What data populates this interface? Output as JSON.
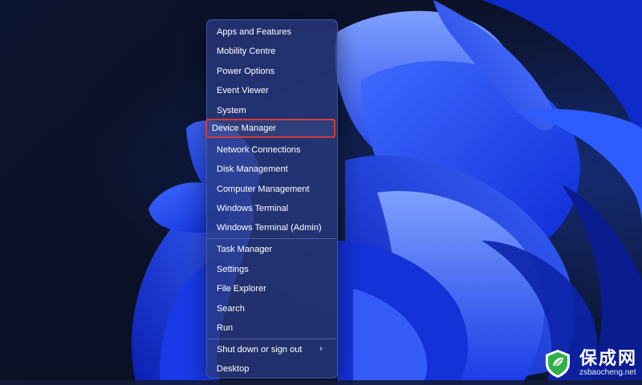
{
  "context_menu": {
    "items": [
      {
        "label": "Apps and Features"
      },
      {
        "label": "Mobility Centre"
      },
      {
        "label": "Power Options"
      },
      {
        "label": "Event Viewer"
      },
      {
        "label": "System"
      },
      {
        "label": "Device Manager",
        "highlighted": true
      },
      {
        "label": "Network Connections"
      },
      {
        "label": "Disk Management"
      },
      {
        "label": "Computer Management"
      },
      {
        "label": "Windows Terminal"
      },
      {
        "label": "Windows Terminal (Admin)"
      },
      {
        "label": "Task Manager"
      },
      {
        "label": "Settings"
      },
      {
        "label": "File Explorer"
      },
      {
        "label": "Search"
      },
      {
        "label": "Run"
      },
      {
        "label": "Shut down or sign out",
        "submenu_icon": "chevron-right-icon"
      },
      {
        "label": "Desktop"
      }
    ]
  },
  "watermark": {
    "title": "保成网",
    "url": "zsbaocheng.net",
    "logo_icon": "shield-leaf-icon",
    "logo_color": "#2fae4a"
  },
  "colors": {
    "highlight_border": "#d43a3a",
    "menu_background": "#283a80",
    "wallpaper_accent": "#2a55ff"
  }
}
